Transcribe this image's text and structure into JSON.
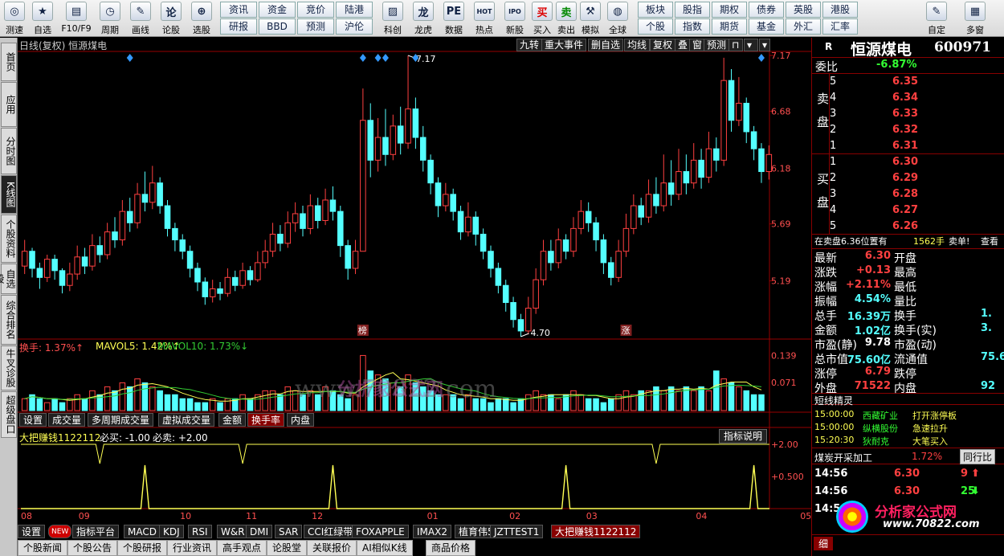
{
  "toolbar": {
    "items": [
      {
        "label": "测速",
        "icon": "speed-icon",
        "glyph": "◎"
      },
      {
        "label": "自选",
        "icon": "star-icon",
        "glyph": "★"
      },
      {
        "label": "F10/F9",
        "icon": "f10-icon",
        "glyph": "▤"
      },
      {
        "label": "周期",
        "icon": "clock-icon",
        "glyph": "◷"
      },
      {
        "label": "画线",
        "icon": "pencil-icon",
        "glyph": "✎"
      },
      {
        "label": "论股",
        "icon": "forum-icon",
        "glyph": "论"
      },
      {
        "label": "选股",
        "icon": "pick-stock-icon",
        "glyph": "⊕"
      }
    ],
    "grid": [
      {
        "top": "资讯",
        "bottom": "研报"
      },
      {
        "top": "资金",
        "bottom": "BBD"
      },
      {
        "top": "竞价",
        "bottom": "预测"
      },
      {
        "top": "陆港",
        "bottom": "沪伦"
      }
    ],
    "items2": [
      {
        "label": "科创",
        "icon": "kechuang-icon",
        "glyph": "▨"
      },
      {
        "label": "龙虎",
        "icon": "dragon-tiger-icon",
        "glyph": "龙"
      },
      {
        "label": "数据",
        "icon": "data-icon",
        "glyph": "PE"
      },
      {
        "label": "热点",
        "icon": "hot-icon",
        "glyph": "HOT"
      },
      {
        "label": "新股",
        "icon": "ipo-icon",
        "glyph": "IPO"
      },
      {
        "label": "买入",
        "icon": "buy-icon",
        "glyph": "买"
      },
      {
        "label": "卖出",
        "icon": "sell-icon",
        "glyph": "卖"
      },
      {
        "label": "模拟",
        "icon": "hammer-icon",
        "glyph": "⚒"
      },
      {
        "label": "全球",
        "icon": "globe-icon",
        "glyph": "◍"
      }
    ],
    "grid2": [
      {
        "top": "板块",
        "bottom": "个股"
      },
      {
        "top": "股指",
        "bottom": "指数"
      },
      {
        "top": "期权",
        "bottom": "期货"
      },
      {
        "top": "债券",
        "bottom": "基金"
      },
      {
        "top": "英股",
        "bottom": "外汇"
      },
      {
        "top": "港股",
        "bottom": "汇率"
      }
    ],
    "items3": [
      {
        "label": "自定",
        "icon": "custom-icon",
        "glyph": "✎"
      },
      {
        "label": "多窗",
        "icon": "multi-window-icon",
        "glyph": "▦"
      }
    ]
  },
  "left_tabs": [
    "首页",
    "应用",
    "分时图",
    "K线图",
    "个股资料",
    "自选股",
    "综合排名",
    "牛叉诊股",
    "超级盘口"
  ],
  "chart": {
    "header_left": "日线(复权) 恒源煤电",
    "top_tabs": [
      "九转",
      "重大事件",
      "删自选",
      "均线",
      "复权",
      "叠",
      "窗",
      "预测"
    ],
    "price_labels": [
      "7.17",
      "6.68",
      "6.18",
      "5.69",
      "5.19"
    ],
    "high_label": "7.17",
    "low_label": "4.70",
    "markers": [
      "榜",
      "涨"
    ],
    "vol_header": {
      "a": "换手: 1.37%↑",
      "b": "MAVOL5: 1.42%↑",
      "c": "MAVOL10: 1.73%↓"
    },
    "vol_labels": [
      "0.139",
      "0.071"
    ],
    "mid_tabs": [
      "设置",
      "成交量",
      "多周期成交量",
      "虚拟成交量",
      "金额",
      "换手率",
      "内盘"
    ],
    "ind_header": {
      "a": "大把赚钱1122112",
      "b": "必买: -1.00",
      "c": "必卖: +2.00"
    },
    "ind_button": "指标说明",
    "ind_labels": [
      "+2.00",
      "+0.500"
    ],
    "months": [
      "08",
      "09",
      "10",
      "11",
      "12",
      "01",
      "02",
      "03",
      "04",
      "05"
    ],
    "watermark": "www.70822.com",
    "watermark_cn": "分析家公式网",
    "colors": {
      "up": "#ff4040",
      "down": "#54ffff",
      "ind": "#ffff54"
    },
    "chart_data": {
      "type": "candlestick",
      "ylim": [
        4.7,
        7.17
      ],
      "candles": [
        {
          "o": 5.32,
          "c": 5.45,
          "h": 5.55,
          "l": 5.25
        },
        {
          "o": 5.45,
          "c": 5.3,
          "h": 5.48,
          "l": 5.22
        },
        {
          "o": 5.3,
          "c": 5.22,
          "h": 5.35,
          "l": 5.12
        },
        {
          "o": 5.22,
          "c": 5.38,
          "h": 5.42,
          "l": 5.18
        },
        {
          "o": 5.38,
          "c": 5.28,
          "h": 5.42,
          "l": 5.2
        },
        {
          "o": 5.28,
          "c": 5.15,
          "h": 5.3,
          "l": 5.08
        },
        {
          "o": 5.15,
          "c": 5.25,
          "h": 5.35,
          "l": 5.1
        },
        {
          "o": 5.25,
          "c": 5.4,
          "h": 5.5,
          "l": 5.2
        },
        {
          "o": 5.4,
          "c": 5.32,
          "h": 5.48,
          "l": 5.25
        },
        {
          "o": 5.32,
          "c": 5.5,
          "h": 5.6,
          "l": 5.28
        },
        {
          "o": 5.5,
          "c": 5.42,
          "h": 5.58,
          "l": 5.35
        },
        {
          "o": 5.42,
          "c": 5.62,
          "h": 5.7,
          "l": 5.38
        },
        {
          "o": 5.62,
          "c": 5.55,
          "h": 5.75,
          "l": 5.48
        },
        {
          "o": 5.55,
          "c": 5.8,
          "h": 5.9,
          "l": 5.5
        },
        {
          "o": 5.8,
          "c": 5.7,
          "h": 5.92,
          "l": 5.62
        },
        {
          "o": 5.7,
          "c": 5.95,
          "h": 6.05,
          "l": 5.65
        },
        {
          "o": 5.95,
          "c": 5.88,
          "h": 6.15,
          "l": 5.8
        },
        {
          "o": 5.88,
          "c": 6.05,
          "h": 6.2,
          "l": 5.82
        },
        {
          "o": 6.05,
          "c": 5.85,
          "h": 6.1,
          "l": 5.78
        },
        {
          "o": 5.85,
          "c": 5.65,
          "h": 5.9,
          "l": 5.58
        },
        {
          "o": 5.65,
          "c": 5.55,
          "h": 5.7,
          "l": 5.45
        },
        {
          "o": 5.55,
          "c": 5.45,
          "h": 5.6,
          "l": 5.38
        },
        {
          "o": 5.45,
          "c": 5.3,
          "h": 5.5,
          "l": 5.22
        },
        {
          "o": 5.3,
          "c": 5.18,
          "h": 5.35,
          "l": 5.1
        },
        {
          "o": 5.18,
          "c": 5.05,
          "h": 5.22,
          "l": 4.98
        },
        {
          "o": 5.05,
          "c": 5.12,
          "h": 5.2,
          "l": 5.0
        },
        {
          "o": 5.12,
          "c": 5.08,
          "h": 5.18,
          "l": 5.02
        },
        {
          "o": 5.08,
          "c": 5.22,
          "h": 5.3,
          "l": 5.05
        },
        {
          "o": 5.22,
          "c": 5.15,
          "h": 5.28,
          "l": 5.1
        },
        {
          "o": 5.15,
          "c": 5.28,
          "h": 5.35,
          "l": 5.12
        },
        {
          "o": 5.28,
          "c": 5.2,
          "h": 5.32,
          "l": 5.15
        },
        {
          "o": 5.2,
          "c": 5.35,
          "h": 5.45,
          "l": 5.18
        },
        {
          "o": 5.35,
          "c": 5.45,
          "h": 5.55,
          "l": 5.3
        },
        {
          "o": 5.45,
          "c": 5.6,
          "h": 5.7,
          "l": 5.4
        },
        {
          "o": 5.6,
          "c": 5.52,
          "h": 5.68,
          "l": 5.45
        },
        {
          "o": 5.52,
          "c": 5.7,
          "h": 5.8,
          "l": 5.48
        },
        {
          "o": 5.7,
          "c": 5.78,
          "h": 5.88,
          "l": 5.62
        },
        {
          "o": 5.78,
          "c": 5.65,
          "h": 5.85,
          "l": 5.58
        },
        {
          "o": 5.65,
          "c": 5.85,
          "h": 5.95,
          "l": 5.6
        },
        {
          "o": 5.85,
          "c": 5.72,
          "h": 5.92,
          "l": 5.65
        },
        {
          "o": 5.72,
          "c": 5.9,
          "h": 6.0,
          "l": 5.68
        },
        {
          "o": 5.9,
          "c": 5.8,
          "h": 6.02,
          "l": 5.72
        },
        {
          "o": 5.8,
          "c": 5.5,
          "h": 5.85,
          "l": 5.4
        },
        {
          "o": 5.5,
          "c": 5.3,
          "h": 5.55,
          "l": 5.2
        },
        {
          "o": 5.3,
          "c": 5.45,
          "h": 5.55,
          "l": 5.25
        },
        {
          "o": 5.45,
          "c": 6.6,
          "h": 6.88,
          "l": 5.45
        },
        {
          "o": 6.6,
          "c": 6.25,
          "h": 6.75,
          "l": 6.1
        },
        {
          "o": 6.25,
          "c": 6.45,
          "h": 6.62,
          "l": 6.15
        },
        {
          "o": 6.45,
          "c": 6.3,
          "h": 6.7,
          "l": 6.2
        },
        {
          "o": 6.3,
          "c": 6.55,
          "h": 6.65,
          "l": 6.25
        },
        {
          "o": 6.55,
          "c": 6.4,
          "h": 6.72,
          "l": 6.3
        },
        {
          "o": 6.4,
          "c": 6.7,
          "h": 7.17,
          "l": 6.35
        },
        {
          "o": 6.7,
          "c": 6.45,
          "h": 6.8,
          "l": 6.35
        },
        {
          "o": 6.45,
          "c": 6.25,
          "h": 6.55,
          "l": 6.15
        },
        {
          "o": 6.25,
          "c": 6.05,
          "h": 6.3,
          "l": 5.95
        },
        {
          "o": 6.05,
          "c": 5.85,
          "h": 6.1,
          "l": 5.75
        },
        {
          "o": 5.85,
          "c": 5.95,
          "h": 6.05,
          "l": 5.8
        },
        {
          "o": 5.95,
          "c": 5.8,
          "h": 6.0,
          "l": 5.72
        },
        {
          "o": 5.8,
          "c": 5.62,
          "h": 5.85,
          "l": 5.55
        },
        {
          "o": 5.62,
          "c": 5.75,
          "h": 5.88,
          "l": 5.58
        },
        {
          "o": 5.75,
          "c": 5.6,
          "h": 5.8,
          "l": 5.5
        },
        {
          "o": 5.6,
          "c": 5.45,
          "h": 5.65,
          "l": 5.38
        },
        {
          "o": 5.45,
          "c": 5.3,
          "h": 5.5,
          "l": 5.22
        },
        {
          "o": 5.3,
          "c": 5.15,
          "h": 5.35,
          "l": 5.08
        },
        {
          "o": 5.15,
          "c": 5.0,
          "h": 5.2,
          "l": 4.92
        },
        {
          "o": 5.0,
          "c": 4.85,
          "h": 5.05,
          "l": 4.78
        },
        {
          "o": 4.85,
          "c": 4.75,
          "h": 4.9,
          "l": 4.7
        },
        {
          "o": 4.75,
          "c": 4.95,
          "h": 5.05,
          "l": 4.72
        },
        {
          "o": 4.95,
          "c": 5.2,
          "h": 5.3,
          "l": 4.9
        },
        {
          "o": 5.2,
          "c": 5.45,
          "h": 5.55,
          "l": 5.15
        },
        {
          "o": 5.45,
          "c": 5.35,
          "h": 5.55,
          "l": 5.28
        },
        {
          "o": 5.35,
          "c": 5.55,
          "h": 5.65,
          "l": 5.3
        },
        {
          "o": 5.55,
          "c": 5.45,
          "h": 5.6,
          "l": 5.38
        },
        {
          "o": 5.45,
          "c": 5.65,
          "h": 5.75,
          "l": 5.4
        },
        {
          "o": 5.65,
          "c": 5.8,
          "h": 5.9,
          "l": 5.6
        },
        {
          "o": 5.8,
          "c": 5.7,
          "h": 5.88,
          "l": 5.62
        },
        {
          "o": 5.7,
          "c": 5.55,
          "h": 5.75,
          "l": 5.45
        },
        {
          "o": 5.55,
          "c": 5.35,
          "h": 5.6,
          "l": 5.25
        },
        {
          "o": 5.35,
          "c": 5.22,
          "h": 5.4,
          "l": 5.15
        },
        {
          "o": 5.22,
          "c": 5.45,
          "h": 5.55,
          "l": 5.18
        },
        {
          "o": 5.45,
          "c": 5.65,
          "h": 5.78,
          "l": 5.4
        },
        {
          "o": 5.65,
          "c": 5.85,
          "h": 5.95,
          "l": 5.6
        },
        {
          "o": 5.85,
          "c": 5.75,
          "h": 5.92,
          "l": 5.68
        },
        {
          "o": 5.75,
          "c": 5.95,
          "h": 6.08,
          "l": 5.7
        },
        {
          "o": 5.95,
          "c": 5.85,
          "h": 6.1,
          "l": 5.78
        },
        {
          "o": 5.85,
          "c": 6.05,
          "h": 6.3,
          "l": 5.8
        },
        {
          "o": 6.05,
          "c": 5.95,
          "h": 6.25,
          "l": 5.85
        },
        {
          "o": 5.95,
          "c": 6.15,
          "h": 6.35,
          "l": 5.9
        },
        {
          "o": 6.15,
          "c": 6.05,
          "h": 6.3,
          "l": 5.95
        },
        {
          "o": 6.05,
          "c": 6.25,
          "h": 6.4,
          "l": 6.0
        },
        {
          "o": 6.25,
          "c": 6.1,
          "h": 6.35,
          "l": 6.0
        },
        {
          "o": 6.1,
          "c": 6.35,
          "h": 6.5,
          "l": 6.05
        },
        {
          "o": 6.35,
          "c": 6.25,
          "h": 6.45,
          "l": 6.15
        },
        {
          "o": 6.25,
          "c": 6.95,
          "h": 7.15,
          "l": 6.2
        },
        {
          "o": 6.95,
          "c": 6.6,
          "h": 7.05,
          "l": 6.5
        },
        {
          "o": 6.6,
          "c": 6.75,
          "h": 6.98,
          "l": 6.55
        },
        {
          "o": 6.75,
          "c": 6.5,
          "h": 6.8,
          "l": 6.4
        },
        {
          "o": 6.5,
          "c": 6.35,
          "h": 6.55,
          "l": 6.25
        },
        {
          "o": 6.35,
          "c": 6.15,
          "h": 6.4,
          "l": 6.05
        },
        {
          "o": 6.15,
          "c": 6.3,
          "h": 6.38,
          "l": 6.08
        }
      ],
      "volume": [
        0.03,
        0.04,
        0.03,
        0.02,
        0.03,
        0.02,
        0.03,
        0.04,
        0.03,
        0.05,
        0.04,
        0.06,
        0.05,
        0.07,
        0.06,
        0.08,
        0.07,
        0.06,
        0.05,
        0.04,
        0.04,
        0.03,
        0.03,
        0.02,
        0.02,
        0.03,
        0.02,
        0.03,
        0.03,
        0.04,
        0.03,
        0.04,
        0.05,
        0.05,
        0.04,
        0.06,
        0.05,
        0.04,
        0.05,
        0.04,
        0.06,
        0.05,
        0.04,
        0.03,
        0.04,
        0.139,
        0.1,
        0.09,
        0.08,
        0.07,
        0.06,
        0.09,
        0.07,
        0.06,
        0.05,
        0.04,
        0.04,
        0.04,
        0.03,
        0.04,
        0.03,
        0.03,
        0.02,
        0.03,
        0.03,
        0.02,
        0.03,
        0.04,
        0.05,
        0.04,
        0.04,
        0.03,
        0.04,
        0.05,
        0.04,
        0.03,
        0.03,
        0.02,
        0.03,
        0.04,
        0.05,
        0.04,
        0.05,
        0.05,
        0.06,
        0.05,
        0.06,
        0.05,
        0.06,
        0.05,
        0.06,
        0.05,
        0.1,
        0.08,
        0.07,
        0.06,
        0.05,
        0.04,
        0.04
      ],
      "indicator_buy_at": [
        16,
        41,
        72,
        97
      ],
      "indicator_sell_at": [
        10,
        29,
        84
      ]
    }
  },
  "right": {
    "r": "R",
    "name": "恒源煤电",
    "code": "600971",
    "wb_label": "委比",
    "wb_val": "-6.87%",
    "sell_label": "卖盘",
    "buy_label": "买盘",
    "sell": [
      {
        "n": "5",
        "p": "6.35"
      },
      {
        "n": "4",
        "p": "6.34"
      },
      {
        "n": "3",
        "p": "6.33"
      },
      {
        "n": "2",
        "p": "6.32"
      },
      {
        "n": "1",
        "p": "6.31"
      }
    ],
    "buy": [
      {
        "n": "1",
        "p": "6.30"
      },
      {
        "n": "2",
        "p": "6.29"
      },
      {
        "n": "3",
        "p": "6.28"
      },
      {
        "n": "4",
        "p": "6.27"
      },
      {
        "n": "5",
        "p": "6.26"
      }
    ],
    "notice": {
      "a": "在卖盘6.36位置有",
      "b": "1562手",
      "c": "卖单!",
      "d": "查看"
    },
    "quotes": [
      {
        "k": "最新",
        "v": "6.30",
        "k2": "开盘",
        "v2": ""
      },
      {
        "k": "涨跌",
        "v": "+0.13",
        "k2": "最高",
        "v2": ""
      },
      {
        "k": "涨幅",
        "v": "+2.11%",
        "k2": "最低",
        "v2": ""
      },
      {
        "k": "振幅",
        "v": "4.54%",
        "k2": "量比",
        "v2": ""
      },
      {
        "k": "总手",
        "v": "16.39万",
        "k2": "换手",
        "v2": "1."
      },
      {
        "k": "金额",
        "v": "1.02亿",
        "k2": "换手(实)",
        "v2": "3."
      },
      {
        "k": "市盈(静)",
        "v": "9.78",
        "k2": "市盈(动)",
        "v2": ""
      },
      {
        "k": "总市值",
        "v": "75.60亿",
        "k2": "流通值",
        "v2": "75.6"
      },
      {
        "k": "涨停",
        "v": "6.79",
        "k2": "跌停",
        "v2": ""
      },
      {
        "k": "外盘",
        "v": "71522",
        "k2": "内盘",
        "v2": "92"
      }
    ],
    "dxjl": "短线精灵",
    "dx": [
      {
        "t": "15:00:00",
        "s": "西藏矿业",
        "e": "打开涨停板"
      },
      {
        "t": "15:00:00",
        "s": "纵横股份",
        "e": "急速拉升"
      },
      {
        "t": "15:20:30",
        "s": "狄耐克",
        "e": "大笔买入"
      }
    ],
    "sector": {
      "name": "煤炭开采加工",
      "pct": "1.72%",
      "btn": "同行比"
    },
    "ticks": [
      {
        "t": "14:56",
        "p": "6.30",
        "n": "9",
        "dir": "up"
      },
      {
        "t": "14:56",
        "p": "6.30",
        "n": "25",
        "dir": "down"
      },
      {
        "t": "14:5",
        "p": "",
        "n": "",
        "dir": ""
      }
    ],
    "logo_cn": "分析家公式网",
    "logo_url": "www.70822.com",
    "detail_tab": "细"
  },
  "bottom": {
    "tabs": [
      "设置",
      "指标平台",
      "MACD",
      "KDJ",
      "RSI",
      "W&R",
      "DMI",
      "SAR",
      "CCI红绿带",
      "FOXAPPLE",
      "IMAX2",
      "植育伟5",
      "JZTTEST1",
      "大把赚钱1122112"
    ],
    "new_badge": "NEW",
    "gray_tabs": [
      "个股新闻",
      "个股公告",
      "个股研报",
      "行业资讯",
      "高手观点",
      "论股堂",
      "关联报价",
      "AI相似K线",
      "商品价格"
    ]
  }
}
